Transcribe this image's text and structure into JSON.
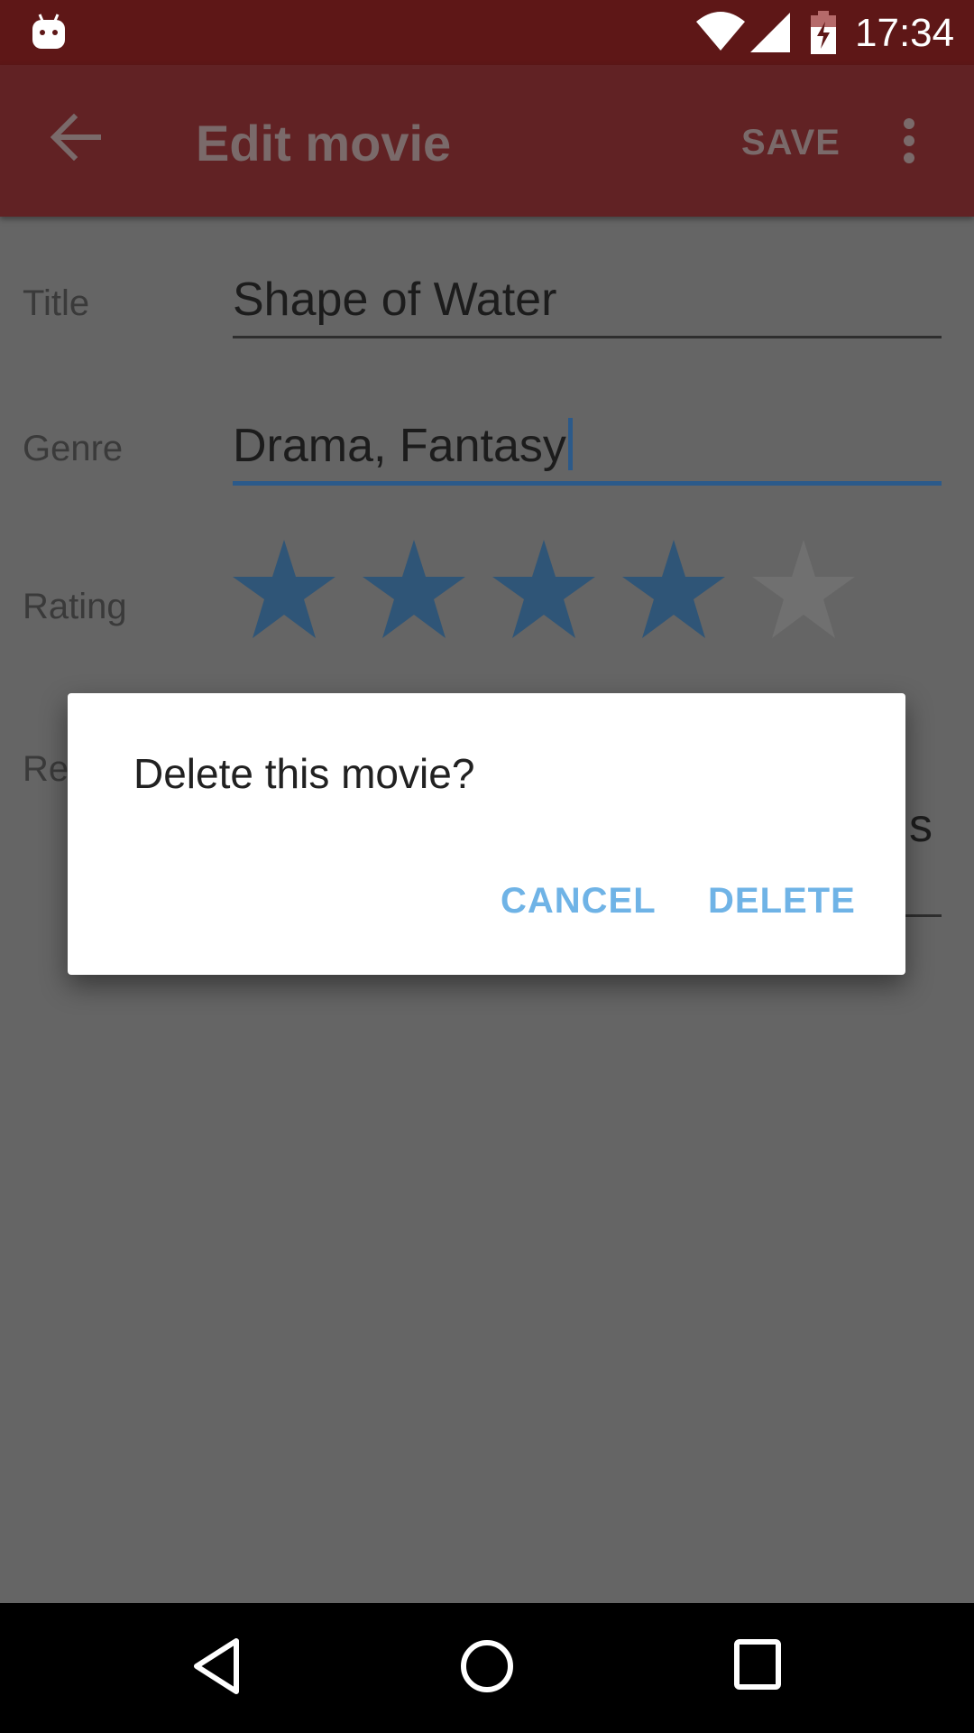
{
  "status_bar": {
    "time": "17:34",
    "icons": [
      "android-robot-icon",
      "wifi-icon",
      "signal-icon",
      "battery-charging-icon"
    ]
  },
  "app_bar": {
    "back_icon": "arrow-back-icon",
    "title": "Edit movie",
    "save_label": "SAVE",
    "more_icon": "more-vert-icon",
    "color": "#612224"
  },
  "form": {
    "title_label": "Title",
    "title_value": "Shape of Water",
    "genre_label": "Genre",
    "genre_value": "Drama, Fantasy",
    "rating_label": "Rating",
    "rating_value": 4,
    "rating_max": 5,
    "review_label_visible": "Re",
    "review_value_visible": "s"
  },
  "dialog": {
    "message": "Delete this movie?",
    "cancel_label": "CANCEL",
    "delete_label": "DELETE",
    "button_color": "#6fb3e6"
  },
  "nav_bar": {
    "icons": [
      "nav-back-icon",
      "nav-home-icon",
      "nav-recents-icon"
    ]
  },
  "colors": {
    "accent": "#2b5a8a",
    "star_filled": "#2f5577",
    "star_empty": "#707070",
    "scrim_background": "#656565"
  }
}
